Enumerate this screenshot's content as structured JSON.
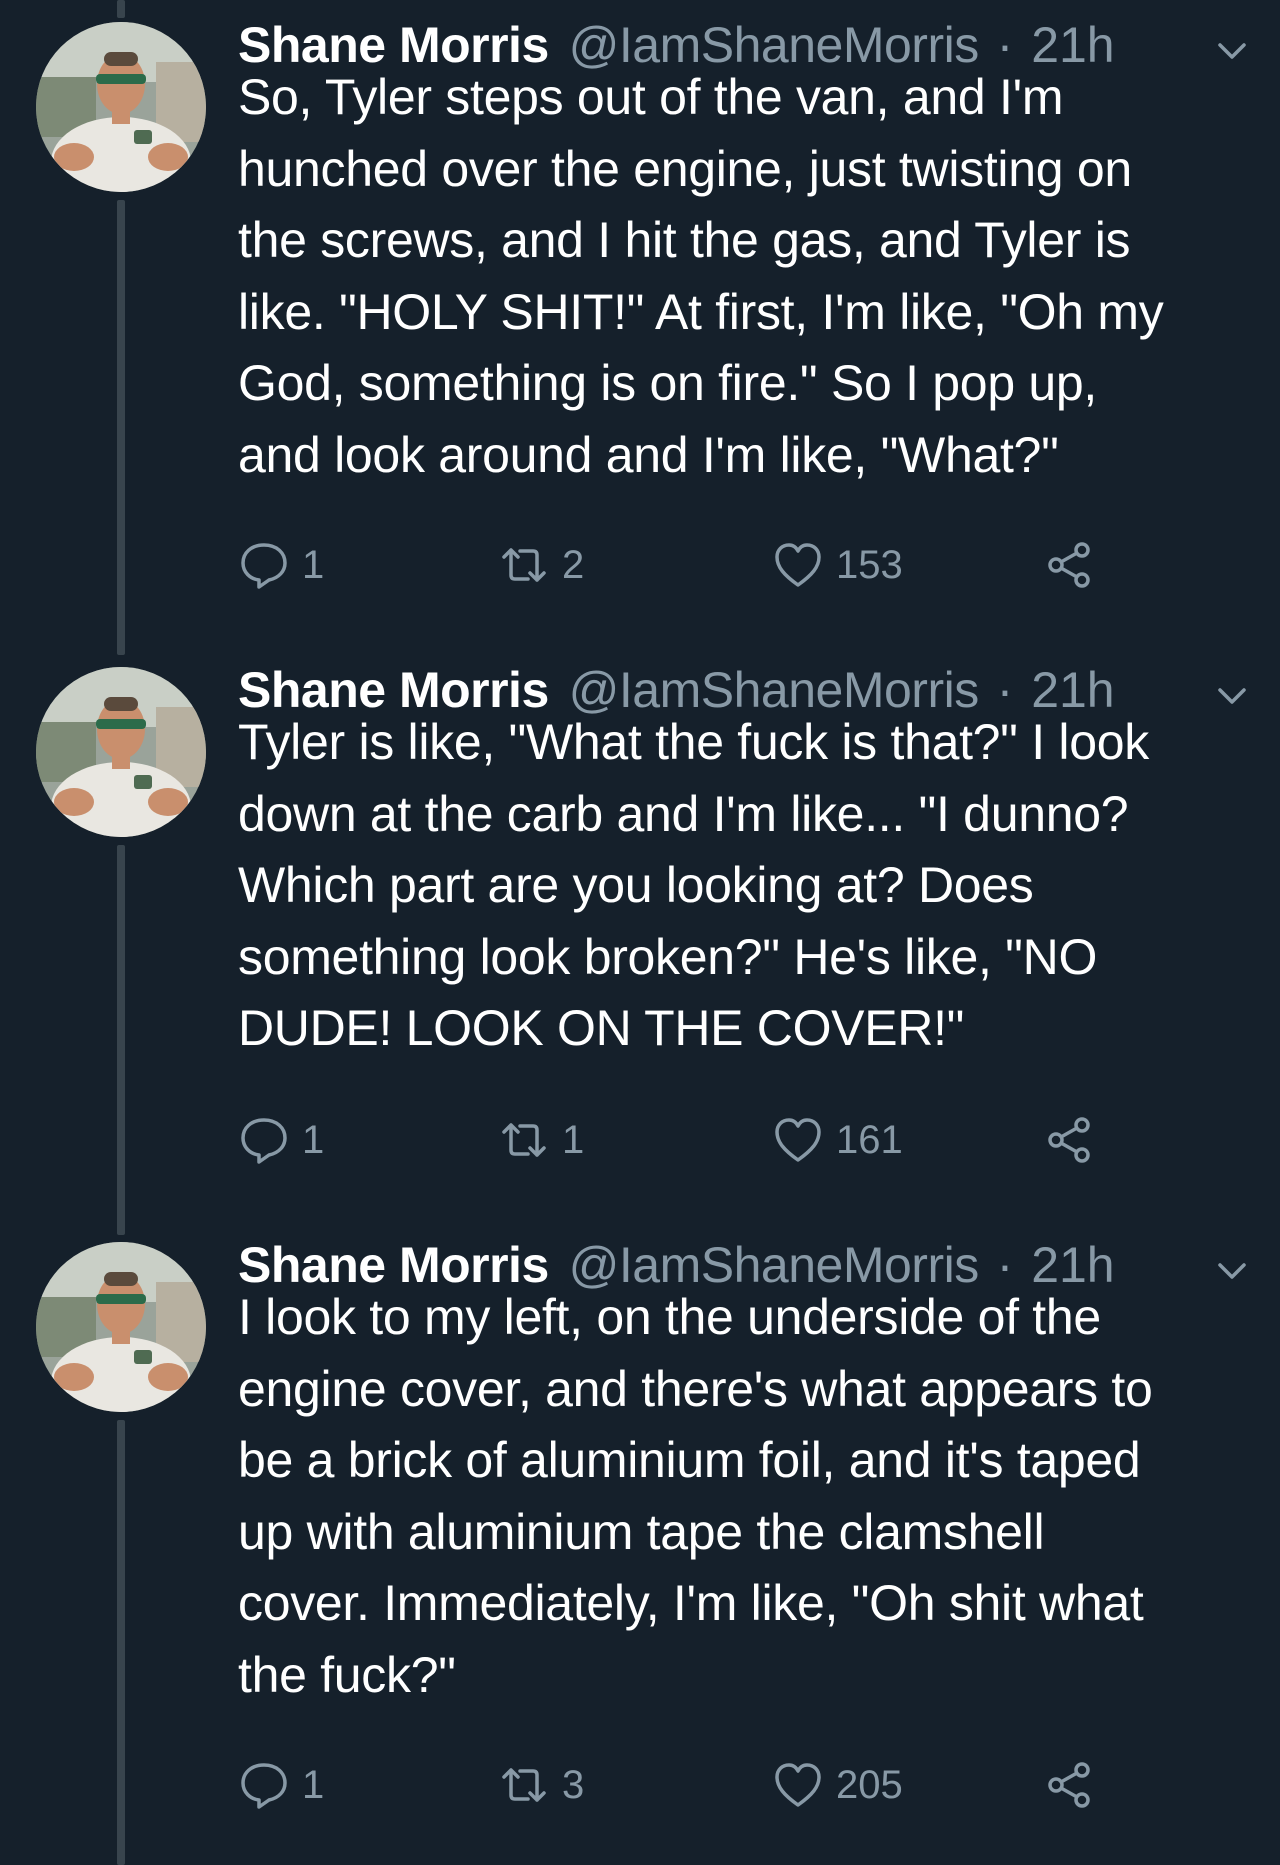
{
  "tweets": [
    {
      "name": "Shane Morris",
      "handle": "@IamShaneMorris",
      "separator": "·",
      "time": "21h",
      "text": "So, Tyler steps out of the van, and I'm\nhunched over the engine, just twisting on\nthe screws, and I hit the gas, and Tyler is\nlike. \"HOLY SHIT!\" At first, I'm like, \"Oh my\nGod, something is on fire.\" So I pop up,\nand look around and I'm like, \"What?\"",
      "replies": "1",
      "retweets": "2",
      "likes": "153"
    },
    {
      "name": "Shane Morris",
      "handle": "@IamShaneMorris",
      "separator": "·",
      "time": "21h",
      "text": "Tyler is like, \"What the fuck is that?\" I look\ndown at the carb and I'm like... \"I dunno?\nWhich part are you looking at? Does\nsomething look broken?\" He's like, \"NO\nDUDE! LOOK ON THE COVER!\"",
      "replies": "1",
      "retweets": "1",
      "likes": "161"
    },
    {
      "name": "Shane Morris",
      "handle": "@IamShaneMorris",
      "separator": "·",
      "time": "21h",
      "text": "I look to my left, on the underside of the\nengine cover, and there's what appears to\nbe a brick of aluminium foil, and it's taped\nup with aluminium tape the clamshell\ncover. Immediately, I'm like, \"Oh shit what\nthe fuck?\"",
      "replies": "1",
      "retweets": "3",
      "likes": "205"
    }
  ],
  "icons": {
    "reply": "reply-icon",
    "retweet": "retweet-icon",
    "like": "heart-icon",
    "share": "share-icon",
    "more": "chevron-down-icon"
  },
  "colors": {
    "background": "#15202b",
    "primary_text": "#ffffff",
    "secondary_text": "#8899a6",
    "thread_line": "#38444d"
  }
}
